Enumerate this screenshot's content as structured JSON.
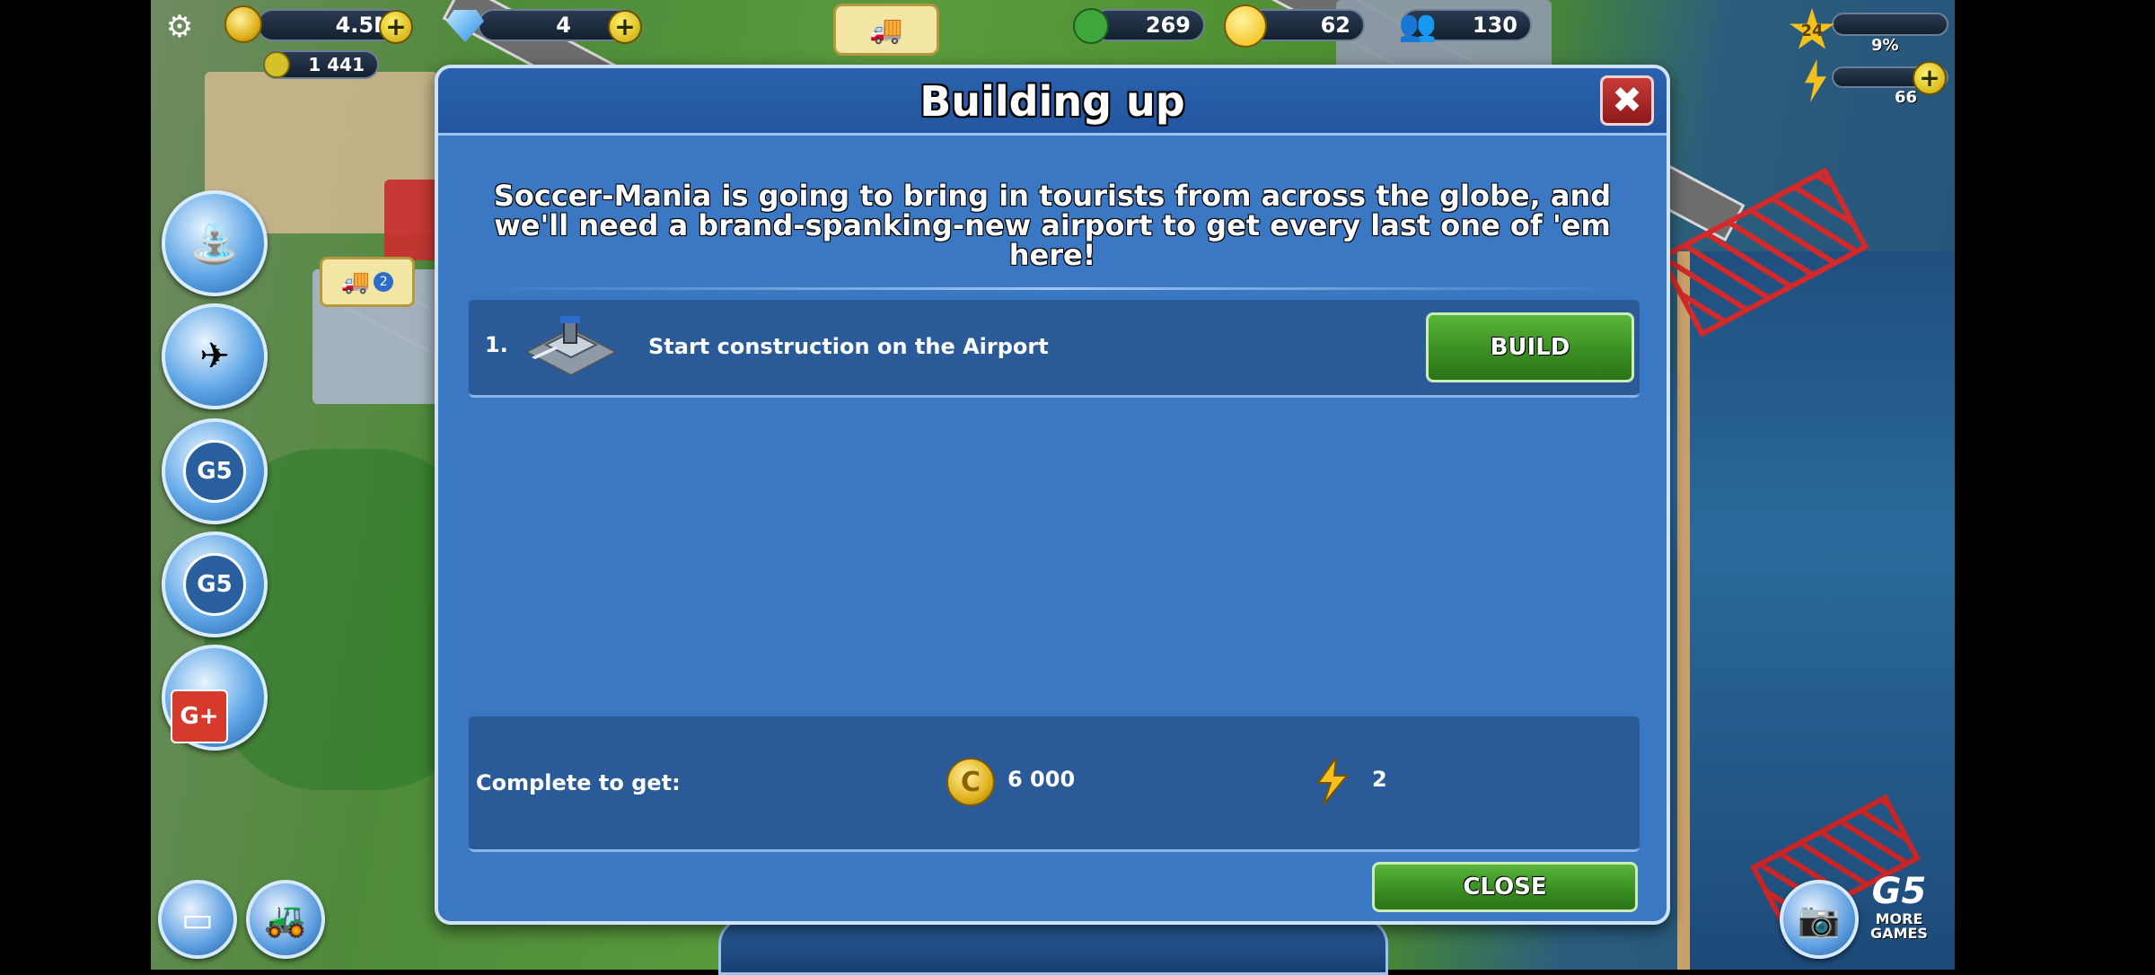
{
  "hud": {
    "coins": "4.5M",
    "gems": "4",
    "secondary_currency": "1 441",
    "trees": "269",
    "happiness": "62",
    "population": "130",
    "level": "24",
    "level_progress": "9%",
    "energy": "66",
    "delivery_badge": "2"
  },
  "dialog": {
    "title": "Building up",
    "intro": "Soccer-Mania is going to bring in tourists from across the globe, and we'll need a brand-spanking-new airport to get every last one of 'em here!",
    "task": {
      "number": "1.",
      "text": "Start construction on the Airport",
      "button": "BUILD"
    },
    "reward": {
      "label": "Complete to get:",
      "coins": "6 000",
      "energy": "2"
    },
    "close_button": "CLOSE"
  },
  "side_buttons": {
    "google_plus": "G+"
  },
  "branding": {
    "more_games_line1": "MORE",
    "more_games_line2": "GAMES",
    "g5": "G5"
  },
  "colors": {
    "dialog_bg": "#3a78c4",
    "button_green": "#3a8f22",
    "close_red": "#c83a3a"
  }
}
